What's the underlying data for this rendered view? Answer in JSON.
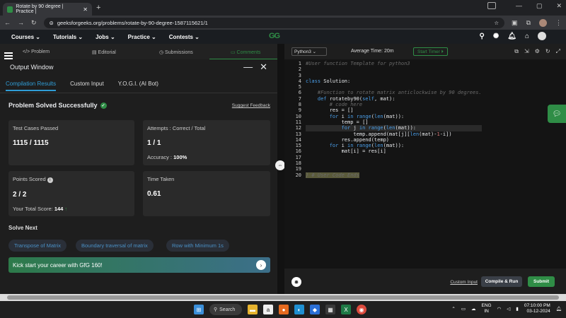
{
  "browser": {
    "tab_title": "Rotate by 90 degree | Practice |",
    "tab_close": "✕",
    "new_tab": "+",
    "url": "geeksforgeeks.org/problems/rotate-by-90-degree-1587115621/1",
    "window_minimize": "—",
    "window_maximize": "▢",
    "window_close": "✕"
  },
  "site_nav": {
    "items": [
      "Courses ⌄",
      "Tutorials ⌄",
      "Jobs ⌄",
      "Practice ⌄",
      "Contests ⌄"
    ],
    "logo": "GG"
  },
  "left_tabs": {
    "problem": "</> Problem",
    "editorial": "▤ Editorial",
    "submissions": "◷ Submissions",
    "comments": "▭ Comments"
  },
  "output_window": {
    "title": "Output Window",
    "minimize": "—",
    "close": "✕",
    "subtabs": [
      "Compilation Results",
      "Custom Input",
      "Y.O.G.I. (AI Bot)"
    ],
    "status": "Problem Solved Successfully",
    "feedback": "Suggest Feedback",
    "cards": {
      "test_cases_label": "Test Cases Passed",
      "test_cases_value": "1115 / 1115",
      "attempts_label": "Attempts : Correct / Total",
      "attempts_value": "1 / 1",
      "accuracy_label": "Accuracy :",
      "accuracy_value": "100%",
      "points_label": "Points Scored",
      "points_value": "2 / 2",
      "total_score_label": "Your Total Score:",
      "total_score_value": "144",
      "time_label": "Time Taken",
      "time_value": "0.61"
    },
    "solve_next_title": "Solve Next",
    "solve_next": [
      "Transpose of Matrix",
      "Boundary traversal of matrix",
      "Row with Minimum 1s"
    ],
    "banner": "Kick start your career with GfG 160!"
  },
  "editor": {
    "language": "Python3 ⌄",
    "avg_time": "Average Time: 20m",
    "timer": "Start Timer ⏵",
    "line_numbers": [
      "1",
      "2",
      "3",
      "4",
      "5",
      "6",
      "7",
      "8",
      "9",
      "10",
      "11",
      "12",
      "13",
      "14",
      "15",
      "16",
      "17",
      "18",
      "19",
      "20"
    ],
    "custom_input": "Custom Input",
    "compile_run": "Compile & Run",
    "submit": "Submit"
  },
  "taskbar": {
    "search": "Search",
    "lang_top": "ENG",
    "lang_bottom": "IN",
    "time": "07:10:00 PM",
    "date": "03-12-2024"
  },
  "colors": {
    "accent_green": "#2f8d46",
    "tab_blue": "#2f9dd6"
  }
}
